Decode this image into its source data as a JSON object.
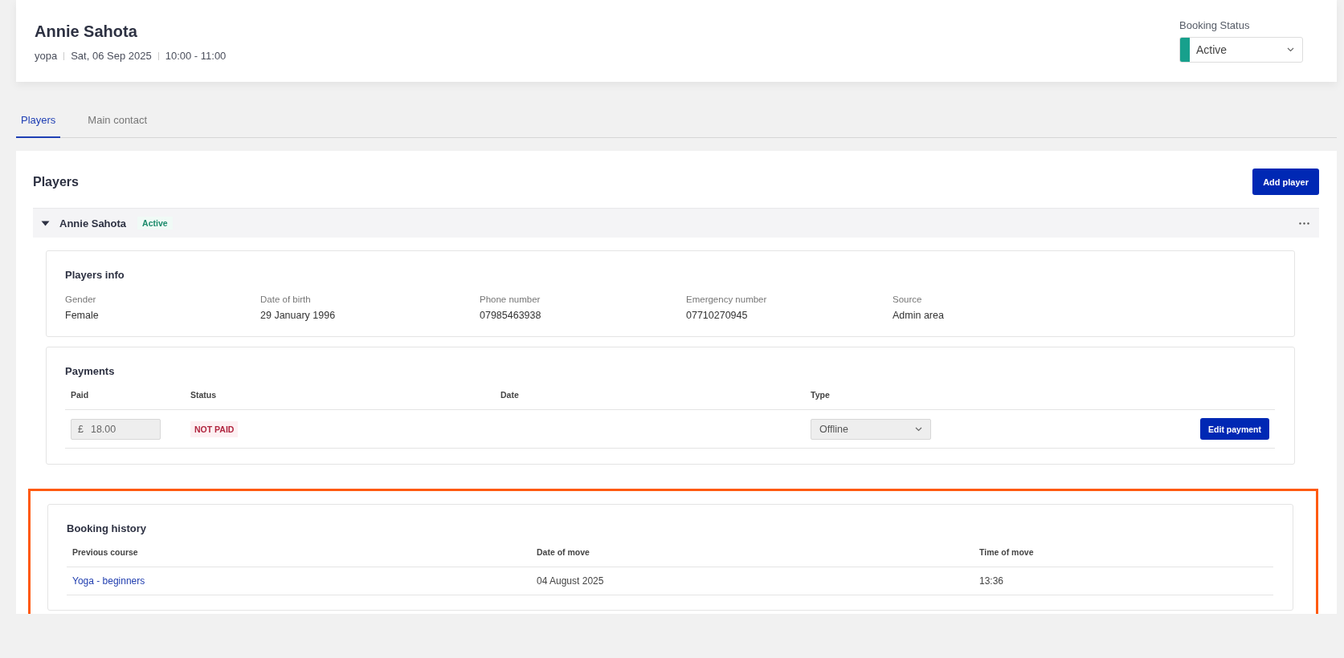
{
  "header": {
    "title": "Annie Sahota",
    "meta": [
      "yopa",
      "Sat, 06 Sep 2025",
      "10:00 - 11:00"
    ],
    "booking_status": {
      "label": "Booking Status",
      "value": "Active",
      "color": "#17a08c"
    }
  },
  "tabs": [
    {
      "label": "Players",
      "selected": true
    },
    {
      "label": "Main contact",
      "selected": false
    }
  ],
  "players": {
    "title": "Players",
    "add_button": "Add player",
    "player": {
      "name": "Annie Sahota",
      "status": "Active",
      "expanded": true
    },
    "info": {
      "title": "Players info",
      "fields": [
        {
          "label": "Gender",
          "value": "Female"
        },
        {
          "label": "Date of birth",
          "value": "29 January 1996"
        },
        {
          "label": "Phone number",
          "value": "07985463938"
        },
        {
          "label": "Emergency number",
          "value": "07710270945"
        },
        {
          "label": "Source",
          "value": "Admin area"
        }
      ]
    },
    "payments": {
      "title": "Payments",
      "columns": [
        "Paid",
        "Status",
        "Date",
        "Type"
      ],
      "rows": [
        {
          "currency": "£",
          "paid": "18.00",
          "status": "NOT PAID",
          "type": "Offline",
          "button": "Edit payment"
        }
      ]
    },
    "booking_history": {
      "title": "Booking history",
      "highlighted": true,
      "columns": [
        "Previous course",
        "Date of move",
        "Time of move"
      ],
      "rows": [
        {
          "previous_course": "Yoga - beginners",
          "date_of_move": "04 August 2025",
          "time_of_move": "13:36"
        }
      ]
    }
  }
}
